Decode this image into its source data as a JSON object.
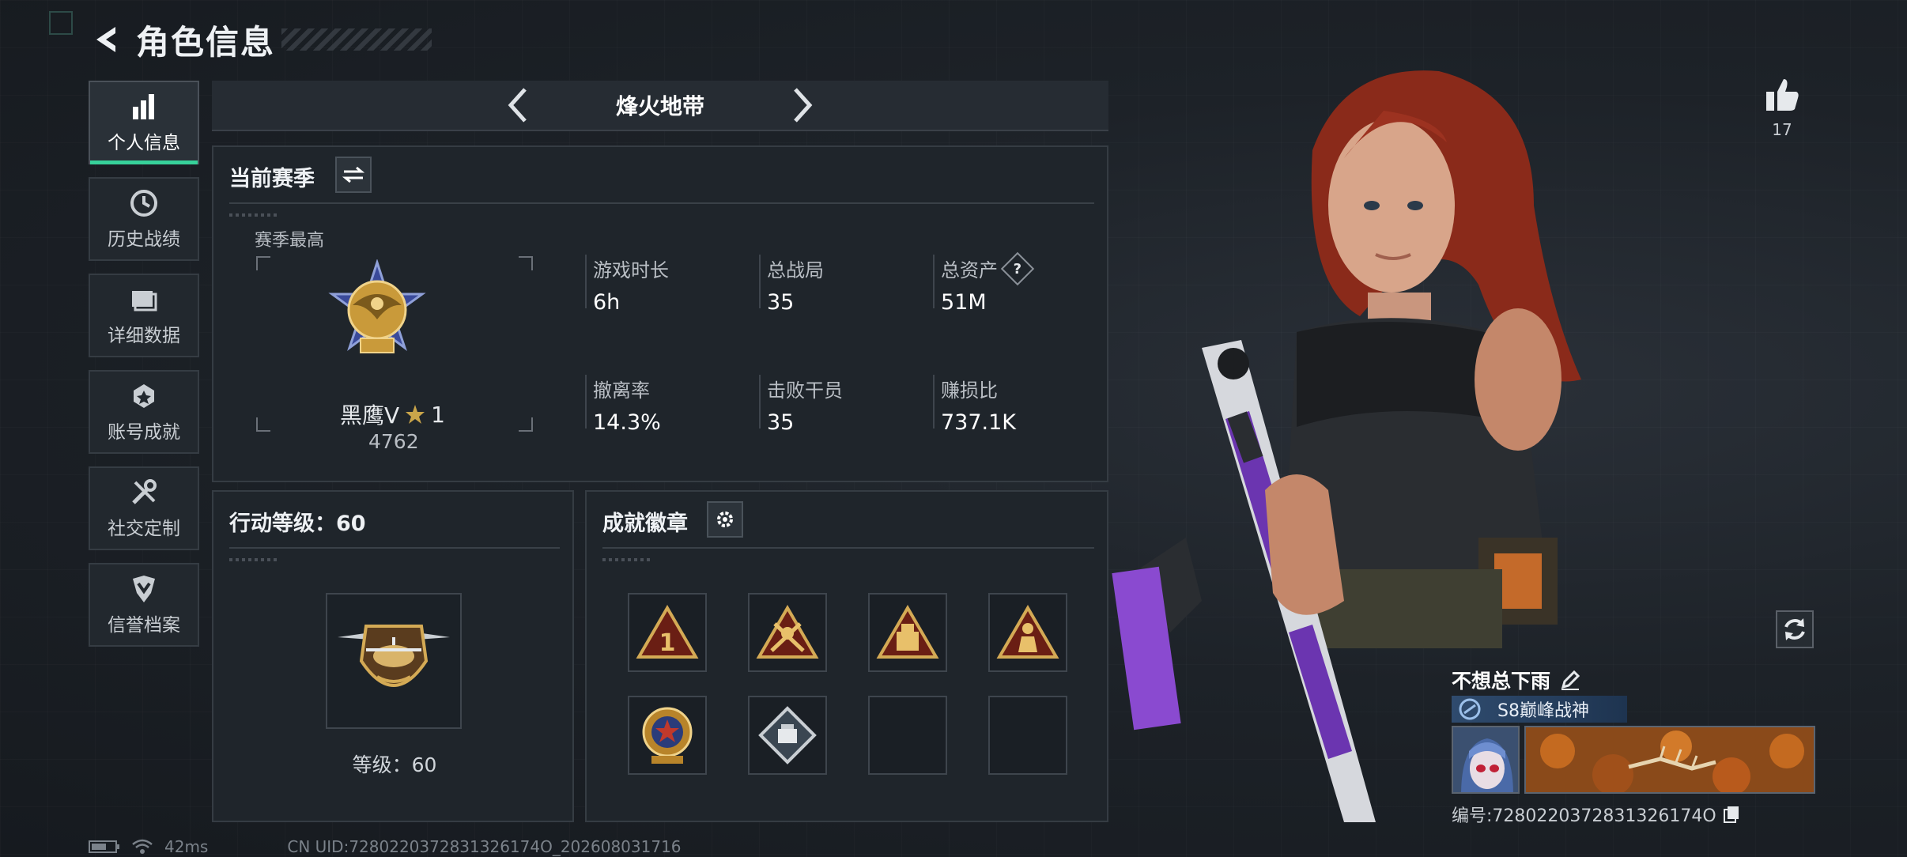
{
  "header": {
    "title": "角色信息"
  },
  "sidebar": {
    "items": [
      {
        "label": "个人信息",
        "icon": "bar-chart-icon",
        "active": true
      },
      {
        "label": "历史战绩",
        "icon": "history-clock-icon",
        "active": false
      },
      {
        "label": "详细数据",
        "icon": "folder-icon",
        "active": false
      },
      {
        "label": "账号成就",
        "icon": "achievement-icon",
        "active": false
      },
      {
        "label": "社交定制",
        "icon": "tools-icon",
        "active": false
      },
      {
        "label": "信誉档案",
        "icon": "shield-icon",
        "active": false
      }
    ]
  },
  "mode": {
    "title": "烽火地带"
  },
  "season": {
    "title": "当前赛季",
    "best_label": "赛季最高",
    "rank_name": "黑鹰V",
    "rank_stars": "1",
    "rank_score": "4762",
    "stats": [
      {
        "label": "游戏时长",
        "value": "6h"
      },
      {
        "label": "总战局",
        "value": "35"
      },
      {
        "label": "总资产",
        "value": "51M",
        "help": "?"
      },
      {
        "label": "撤离率",
        "value": "14.3%"
      },
      {
        "label": "击败干员",
        "value": "35"
      },
      {
        "label": "赚损比",
        "value": "737.1K"
      }
    ]
  },
  "level": {
    "title": "行动等级：60",
    "text": "等级：60"
  },
  "achievements": {
    "title": "成就徽章",
    "filled_slots": 6,
    "total_slots": 8
  },
  "likes": {
    "count": "17"
  },
  "player": {
    "name": "不想总下雨",
    "title": "S8巅峰战神",
    "id_text": "编号:7280220372831326174O"
  },
  "status": {
    "ping": "42ms",
    "uid": "CN UID:7280220372831326174O_202608031716"
  },
  "colors": {
    "accent": "#37d19a",
    "panel": "#1f252b",
    "border": "#353c43",
    "gold": "#c99a3a"
  }
}
